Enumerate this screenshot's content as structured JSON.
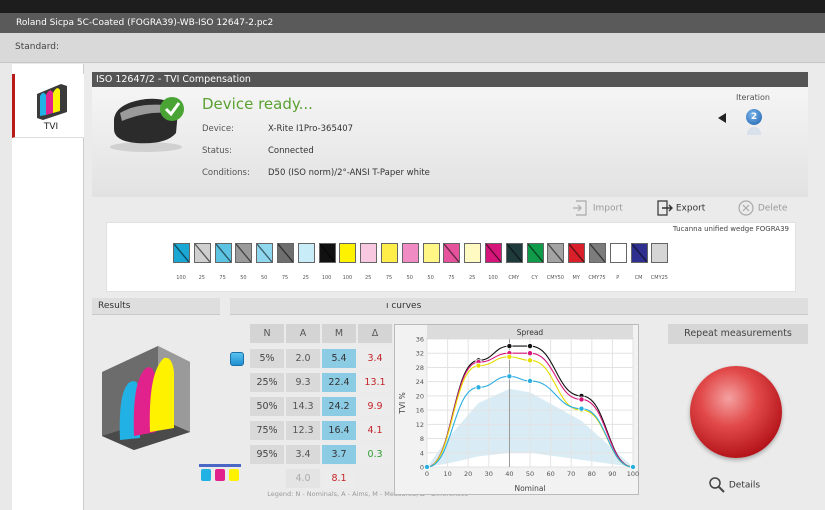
{
  "window": {
    "title": "Roland Sicpa 5C-Coated (FOGRA39)-WB-ISO 12647-2.pc2",
    "standard_label": "Standard:"
  },
  "sidebar": {
    "items": [
      {
        "label": "TVI",
        "icon": "tvi-bars-icon",
        "active": true
      }
    ]
  },
  "panel": {
    "title": "ISO 12647/2 - TVI Compensation"
  },
  "device": {
    "status_heading": "Device ready...",
    "device_label": "Device:",
    "device_value": "X-Rite I1Pro-365407",
    "status_label": "Status:",
    "status_value": "Connected",
    "conditions_label": "Conditions:",
    "conditions_value": "D50 (ISO norm)/2°-ANSI T-Paper white"
  },
  "iteration": {
    "label": "Iteration",
    "value": "2"
  },
  "toolbar": {
    "import": "Import",
    "export": "Export",
    "delete": "Delete"
  },
  "wedge": {
    "title": "Tucanna unified wedge FOGRA39",
    "patches": [
      {
        "color": "#1aa7d4",
        "label": "100",
        "slash": true
      },
      {
        "color": "#cfcfcf",
        "label": "25",
        "slash": true
      },
      {
        "color": "#5cc3e3",
        "label": "75",
        "slash": true
      },
      {
        "color": "#9a9a9a",
        "label": "50",
        "slash": true
      },
      {
        "color": "#8fd6ef",
        "label": "50",
        "slash": true
      },
      {
        "color": "#6e6e6e",
        "label": "75",
        "slash": true
      },
      {
        "color": "#c8ecf8",
        "label": "25",
        "slash": false
      },
      {
        "color": "#111111",
        "label": "100",
        "slash": true
      },
      {
        "color": "#fff200",
        "label": "100",
        "slash": false
      },
      {
        "color": "#f8c7e0",
        "label": "25",
        "slash": false
      },
      {
        "color": "#ffed4a",
        "label": "75",
        "slash": false
      },
      {
        "color": "#f08cc3",
        "label": "50",
        "slash": false
      },
      {
        "color": "#fff685",
        "label": "50",
        "slash": false
      },
      {
        "color": "#e6539c",
        "label": "75",
        "slash": true
      },
      {
        "color": "#fff9c2",
        "label": "25",
        "slash": false
      },
      {
        "color": "#d6157a",
        "label": "100",
        "slash": true
      },
      {
        "color": "#1f3a3a",
        "label": "CMY",
        "slash": true
      },
      {
        "color": "#0f9b4a",
        "label": "CY",
        "slash": true
      },
      {
        "color": "#a3a3a3",
        "label": "CMY50",
        "slash": true
      },
      {
        "color": "#d81f2a",
        "label": "MY",
        "slash": true
      },
      {
        "color": "#7c7c7c",
        "label": "CMY75",
        "slash": true
      },
      {
        "color": "#ffffff",
        "label": "P",
        "slash": false
      },
      {
        "color": "#2f2f8f",
        "label": "CM",
        "slash": true
      },
      {
        "color": "#d5d5d5",
        "label": "CMY25",
        "slash": false
      }
    ]
  },
  "sections": {
    "results": "Results",
    "curves": "ı curves"
  },
  "table": {
    "headers": [
      "N",
      "A",
      "M",
      "Δ"
    ],
    "rows": [
      {
        "n": "5%",
        "a": "2.0",
        "m": "5.4",
        "d": "3.4",
        "d_class": "d-red"
      },
      {
        "n": "25%",
        "a": "9.3",
        "m": "22.4",
        "d": "13.1",
        "d_class": "d-red"
      },
      {
        "n": "50%",
        "a": "14.3",
        "m": "24.2",
        "d": "9.9",
        "d_class": "d-red"
      },
      {
        "n": "75%",
        "a": "12.3",
        "m": "16.4",
        "d": "4.1",
        "d_class": "d-red"
      },
      {
        "n": "95%",
        "a": "3.4",
        "m": "3.7",
        "d": "0.3",
        "d_class": "d-green"
      }
    ],
    "footer_a": "4.0",
    "footer_d": "8.1",
    "legend": "Legend: N - Nominals, A - Aims, M - Measured, Δ - Differences"
  },
  "chart_data": {
    "type": "line",
    "title": "Spread",
    "xlabel": "Nominal",
    "ylabel": "TVI %",
    "xlim": [
      0,
      100
    ],
    "ylim": [
      0,
      36
    ],
    "xticks": [
      0,
      10,
      20,
      30,
      40,
      50,
      60,
      70,
      80,
      90,
      100
    ],
    "yticks": [
      0,
      4,
      8,
      12,
      16,
      20,
      24,
      28,
      32,
      36
    ],
    "grid": true,
    "series": [
      {
        "color": "#111111",
        "x": [
          0,
          25,
          40,
          50,
          75,
          100
        ],
        "y": [
          0,
          30,
          34,
          34,
          20,
          0
        ]
      },
      {
        "color": "#d6157a",
        "x": [
          0,
          25,
          40,
          50,
          75,
          100
        ],
        "y": [
          0,
          29.5,
          32,
          32,
          19,
          0
        ]
      },
      {
        "color": "#e6dd00",
        "x": [
          0,
          25,
          40,
          50,
          75,
          100
        ],
        "y": [
          0,
          28.5,
          31,
          30,
          16,
          0
        ]
      },
      {
        "color": "#2aaee0",
        "x": [
          0,
          25,
          40,
          50,
          75,
          100
        ],
        "y": [
          0,
          22.4,
          25.5,
          24.2,
          16.4,
          0
        ]
      }
    ]
  },
  "repeat": {
    "label": "Repeat measurements",
    "details": "Details"
  }
}
